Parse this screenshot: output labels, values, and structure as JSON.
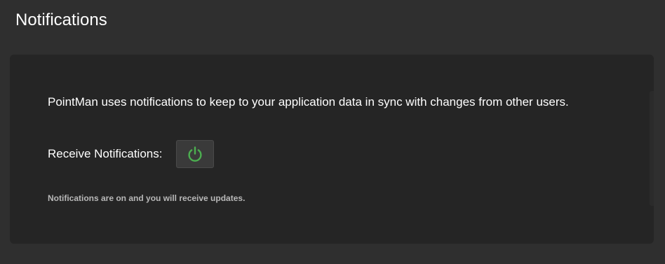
{
  "header": {
    "title": "Notifications"
  },
  "panel": {
    "description": "PointMan uses notifications to keep to your application data in sync with changes from other users.",
    "receive_label": "Receive Notifications:",
    "toggle": {
      "icon": "power-icon",
      "state": "on",
      "icon_color": "#4caf50"
    },
    "status": "Notifications are on and you will receive updates."
  },
  "colors": {
    "background": "#2f2f2f",
    "panel": "#252525",
    "accent": "#4caf50"
  }
}
